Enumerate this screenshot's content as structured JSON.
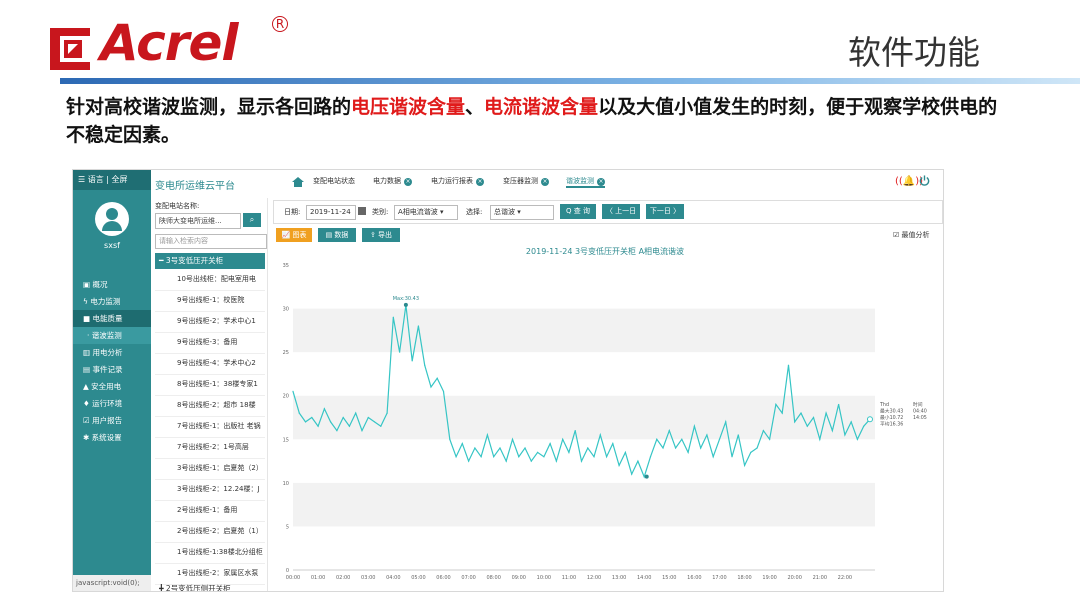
{
  "slide": {
    "brand": "Acrel",
    "title": "软件功能",
    "desc_parts": [
      "针对高校谐波监测，显示各回路的",
      "电压谐波含量",
      "、",
      "电流谐波含量",
      "以及大值小值发生的时刻，便于观察学校供电的不稳定因素。"
    ]
  },
  "app": {
    "topbar_text": "☰ 语言 | 全屏",
    "title": "变电所运维云平台",
    "tabs": [
      "变配电站状态",
      "电力数据",
      "电力运行报表",
      "变压器监测",
      "谐波监测"
    ],
    "username": "sxsf",
    "nav": [
      "概况",
      "电力监测",
      "电能质量",
      "谐波监测",
      "用电分析",
      "事件记录",
      "安全用电",
      "运行环境",
      "用户报告",
      "系统设置"
    ],
    "status": "javascript:void(0);"
  },
  "tree": {
    "station_label": "变配电站名称:",
    "station_value": "陕师大变电所运维...",
    "search_placeholder": "请输入检索内容",
    "group": "━ 3号变低压开关柜",
    "rows": [
      "10号出线柜：配电室用电",
      "9号出线柜-1：校医院",
      "9号出线柜-2：学术中心1",
      "9号出线柜-3：备用",
      "9号出线柜-4：学术中心2",
      "8号出线柜-1：38楼专家1",
      "8号出线柜-2：超市 18楼",
      "7号出线柜-1：出版社 老锅",
      "7号出线柜-2：1号高层",
      "3号出线柜-1：启夏苑（2）",
      "3号出线柜-2：12.24楼：J",
      "2号出线柜-1：备用",
      "2号出线柜-2：启夏苑（1）",
      "1号出线柜-1:38楼北分组柜",
      "1号出线柜-2：家属区水泵"
    ],
    "footer_group": "╋ 2号变低压侧开关柜"
  },
  "filters": {
    "date_label": "日期:",
    "date_value": "2019-11-24",
    "type_label": "类别:",
    "type_value": "A相电流谐波",
    "select_label": "选择:",
    "select_value": "总谐波",
    "query": "Q 查 询",
    "prev": "〈 上一日",
    "next": "下一日 〉"
  },
  "tools": {
    "chart_btn": "图表",
    "data_btn": "数据",
    "export_btn": "导出",
    "checkbox": "最值分析"
  },
  "colors": {
    "teal": "#2d8a8f",
    "line": "#36c5c5",
    "accent_red": "#e01b1b",
    "orange": "#f0a020"
  },
  "chart_data": {
    "type": "line",
    "title": "2019-11-24  3号变低压开关柜  A相电流谐波",
    "x_ticks": [
      "00:00",
      "01:00",
      "02:00",
      "03:00",
      "04:00",
      "05:00",
      "06:00",
      "07:00",
      "08:00",
      "09:00",
      "10:00",
      "11:00",
      "12:00",
      "13:00",
      "14:00",
      "15:00",
      "16:00",
      "17:00",
      "18:00",
      "19:00",
      "20:00",
      "21:00",
      "22:00"
    ],
    "ylim": [
      0,
      35
    ],
    "y_ticks": [
      0,
      5,
      10,
      15,
      20,
      25,
      30,
      35
    ],
    "grid": true,
    "hours": [
      0,
      0.25,
      0.5,
      0.75,
      1,
      1.25,
      1.5,
      1.75,
      2,
      2.25,
      2.5,
      2.75,
      3,
      3.25,
      3.5,
      3.75,
      4,
      4.25,
      4.5,
      4.75,
      5,
      5.25,
      5.5,
      5.75,
      6,
      6.25,
      6.5,
      6.75,
      7,
      7.25,
      7.5,
      7.75,
      8,
      8.25,
      8.5,
      8.75,
      9,
      9.25,
      9.5,
      9.75,
      10,
      10.25,
      10.5,
      10.75,
      11,
      11.25,
      11.5,
      11.75,
      12,
      12.25,
      12.5,
      12.75,
      13,
      13.25,
      13.5,
      13.75,
      14,
      14.25,
      14.5,
      14.75,
      15,
      15.25,
      15.5,
      15.75,
      16,
      16.25,
      16.5,
      16.75,
      17,
      17.25,
      17.5,
      17.75,
      18,
      18.25,
      18.5,
      18.75,
      19,
      19.25,
      19.5,
      19.75,
      20,
      20.25,
      20.5,
      20.75,
      21,
      21.25,
      21.5,
      21.75,
      22,
      22.25,
      22.5,
      22.75,
      23
    ],
    "values": [
      20.5,
      18,
      17,
      17.5,
      16.5,
      18.5,
      17,
      16,
      17.5,
      16.5,
      18,
      16,
      17.5,
      17,
      16.5,
      18,
      29,
      25,
      30.4,
      24,
      28,
      23.5,
      21,
      22,
      20.5,
      15,
      13,
      14.5,
      12.5,
      14,
      13,
      15.5,
      13,
      14,
      12.5,
      15,
      13,
      14,
      12.5,
      13.5,
      13,
      14.5,
      12.5,
      15,
      13.5,
      16,
      12.5,
      14,
      13,
      15.5,
      13,
      14.5,
      12,
      13.5,
      11,
      12.5,
      10.7,
      13,
      15,
      14,
      16,
      14,
      15,
      13.5,
      16.5,
      14,
      15.5,
      13,
      15,
      17,
      13,
      15.5,
      12,
      13.5,
      14,
      16,
      15,
      19,
      18,
      23.5,
      17,
      18,
      16.5,
      17.5,
      15,
      18,
      16,
      19,
      15.5,
      17,
      15,
      16.5,
      17.3
    ],
    "max": {
      "label": "Max:30.43",
      "value": 30.43,
      "hour": 4.5
    },
    "min": {
      "value": 10.72,
      "hour": 14.1
    },
    "legend": [
      {
        "k": "Thd",
        "v": "时间"
      },
      {
        "k": "最大30.43",
        "v": "04:40"
      },
      {
        "k": "最小10.72",
        "v": "14:05"
      },
      {
        "k": "平均16.36",
        "v": ""
      }
    ]
  }
}
